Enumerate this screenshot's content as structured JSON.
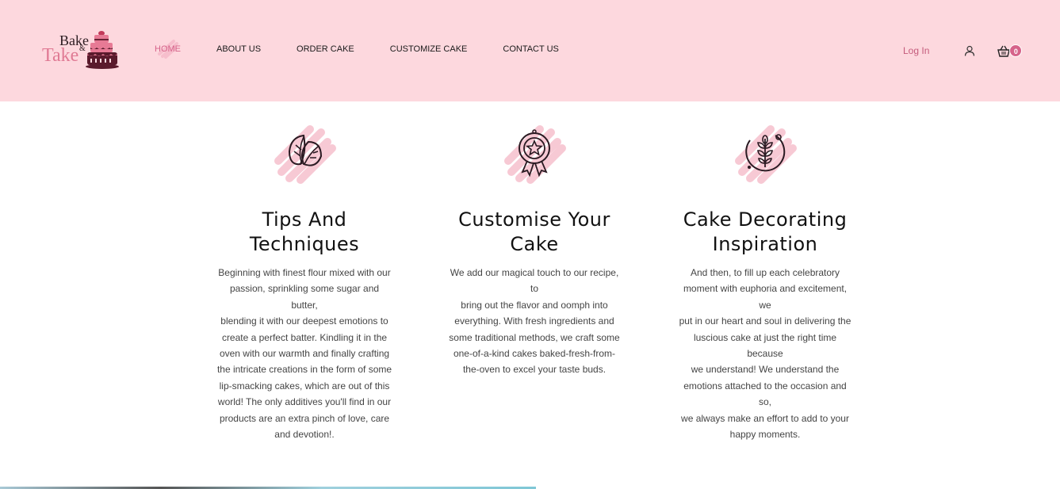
{
  "header": {
    "logo": {
      "line1": "Bake",
      "amp": "&",
      "line2": "Take"
    },
    "nav": [
      {
        "label": "HOME",
        "active": true
      },
      {
        "label": "ABOUT US",
        "active": false
      },
      {
        "label": "ORDER CAKE",
        "active": false
      },
      {
        "label": "CUSTOMIZE CAKE",
        "active": false
      },
      {
        "label": "CONTACT US",
        "active": false
      }
    ],
    "login": "Log In",
    "cart_count": "0",
    "icons": [
      "user-icon",
      "basket-icon"
    ]
  },
  "features": [
    {
      "icon": "leaves-icon",
      "title_line1": "Tips And",
      "title_line2": "Techniques",
      "text_lines": [
        "Beginning with finest flour mixed with our",
        "passion, sprinkling some sugar and butter,",
        "blending it with our deepest emotions to",
        "create a perfect batter. Kindling it in the",
        "oven with our warmth and finally crafting",
        "the intricate creations in the form of some",
        "lip-smacking cakes, which are out of this",
        "world! The only additives you'll find in our",
        "products are an extra pinch of love, care",
        "and devotion!."
      ]
    },
    {
      "icon": "award-ribbon-icon",
      "title_line1": "Customise Your",
      "title_line2": "Cake",
      "text_lines": [
        "We add our magical touch to our recipe, to",
        "bring out the flavor and oomph into",
        "everything. With fresh ingredients and",
        "some traditional methods, we craft some",
        "one-of-a-kind cakes baked-fresh-from-",
        "the-oven to excel your taste buds."
      ]
    },
    {
      "icon": "wheat-icon",
      "title_line1": "Cake Decorating",
      "title_line2": "Inspiration",
      "text_lines": [
        "And then, to fill up each celebratory",
        "moment with euphoria and excitement, we",
        "put in our heart and soul in delivering the",
        "luscious cake at just the right time because",
        "we understand! We understand the",
        "emotions attached to the occasion and so,",
        "we always make an effort to add to your",
        "happy moments."
      ]
    }
  ],
  "colors": {
    "header_bg": "#fdd8de",
    "accent": "#d6638a",
    "brush": "#f7c9d4"
  }
}
